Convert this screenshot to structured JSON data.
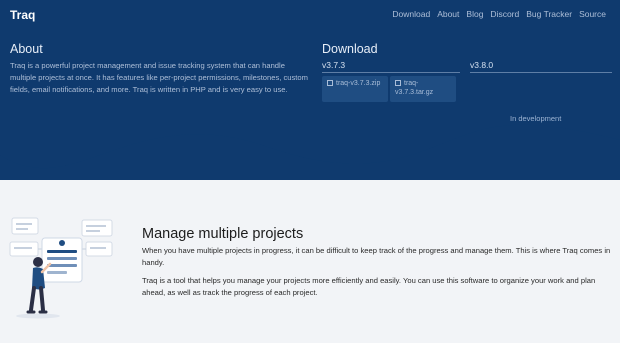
{
  "topbar": {
    "brand": "Traq",
    "nav": [
      "Download",
      "About",
      "Blog",
      "Discord",
      "Bug Tracker",
      "Source"
    ]
  },
  "about": {
    "title": "About",
    "text": "Traq is a powerful project management and issue tracking system that can handle multiple projects at once. It has features like per-project permissions, milestones, custom fields, email notifications, and more. Traq is written in PHP and is very easy to use."
  },
  "download": {
    "title": "Download",
    "stable": {
      "version": "v3.7.3",
      "files": [
        "traq-v3.7.3.zip",
        "traq-v3.7.3.tar.gz"
      ]
    },
    "upcoming": {
      "version": "v3.8.0",
      "status": "In development"
    }
  },
  "feature": {
    "title": "Manage multiple projects",
    "paragraphs": [
      "When you have multiple projects in progress, it can be difficult to keep track of the progress and manage them. This is where Traq comes in handy.",
      "Traq is a tool that helps you manage your projects more efficiently and easily. You can use this software to organize your work and plan ahead, as well as track the progress of each project."
    ]
  },
  "colors": {
    "hero_background": "#0f3a6e",
    "page_background": "#f2f4f7",
    "download_card": "#1f4d82",
    "illustration_accent": "#1f4d82"
  },
  "icons": {
    "file": "archive-file-icon"
  }
}
